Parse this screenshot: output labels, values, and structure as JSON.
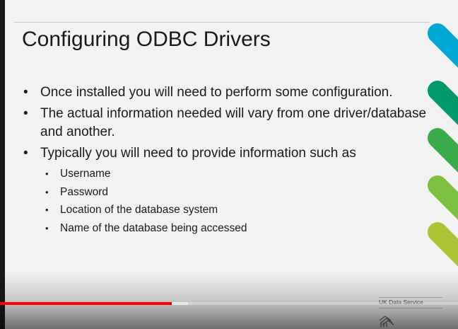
{
  "slide": {
    "title": "Configuring ODBC Drivers",
    "bullets": [
      {
        "text": "Once installed you will need to perform some configuration."
      },
      {
        "text": "The actual information needed will vary from one driver/database and another."
      },
      {
        "text": "Typically you will need to provide information such as"
      }
    ],
    "sub_bullets": [
      "Username",
      "Password",
      "Location of the database system",
      "Name of the database being accessed"
    ],
    "bullet_char": "•",
    "accent_colors": [
      "#00a9d4",
      "#009a6a",
      "#3bab4a",
      "#7dbf3f",
      "#afc337"
    ]
  },
  "branding": {
    "name": "UK Data Service"
  },
  "player": {
    "progress_fraction": 0.375,
    "buffered_fraction": 0.41,
    "progress_color": "#ff0000"
  }
}
